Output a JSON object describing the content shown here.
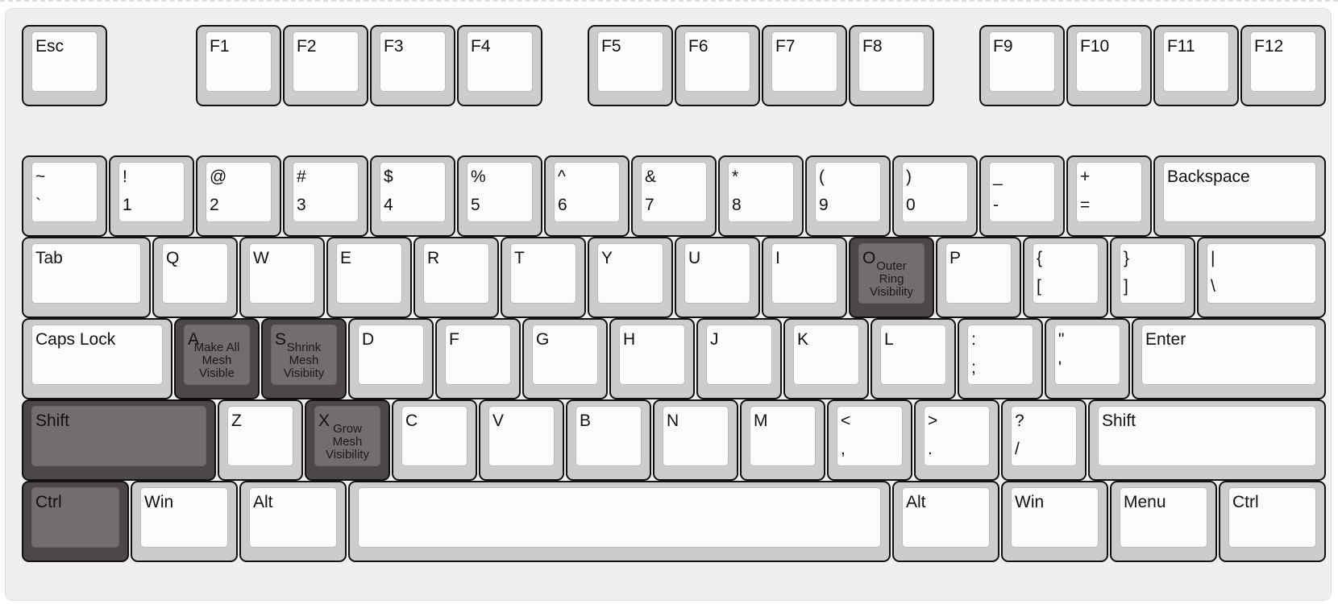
{
  "colors": {
    "key_base": "#cccccc",
    "key_face": "#fcfcfc",
    "highlight_base": "#4d4747",
    "highlight_face": "#736d6d"
  },
  "rows": [
    [
      {
        "top": "Esc"
      },
      {
        "top": "F1"
      },
      {
        "top": "F2"
      },
      {
        "top": "F3"
      },
      {
        "top": "F4"
      },
      {
        "top": "F5"
      },
      {
        "top": "F6"
      },
      {
        "top": "F7"
      },
      {
        "top": "F8"
      },
      {
        "top": "F9"
      },
      {
        "top": "F10"
      },
      {
        "top": "F11"
      },
      {
        "top": "F12"
      }
    ],
    [
      {
        "top": "~",
        "bottom": "`"
      },
      {
        "top": "!",
        "bottom": "1"
      },
      {
        "top": "@",
        "bottom": "2"
      },
      {
        "top": "#",
        "bottom": "3"
      },
      {
        "top": "$",
        "bottom": "4"
      },
      {
        "top": "%",
        "bottom": "5"
      },
      {
        "top": "^",
        "bottom": "6"
      },
      {
        "top": "&",
        "bottom": "7"
      },
      {
        "top": "*",
        "bottom": "8"
      },
      {
        "top": "(",
        "bottom": "9"
      },
      {
        "top": ")",
        "bottom": "0"
      },
      {
        "top": "_",
        "bottom": "-"
      },
      {
        "top": "+",
        "bottom": "="
      },
      {
        "top": "Backspace"
      }
    ],
    [
      {
        "top": "Tab"
      },
      {
        "top": "Q"
      },
      {
        "top": "W"
      },
      {
        "top": "E"
      },
      {
        "top": "R"
      },
      {
        "top": "T"
      },
      {
        "top": "Y"
      },
      {
        "top": "U"
      },
      {
        "top": "I"
      },
      {
        "top": "O",
        "action": "Outer Ring Visibility",
        "highlighted": true
      },
      {
        "top": "P"
      },
      {
        "top": "{",
        "bottom": "["
      },
      {
        "top": "}",
        "bottom": "]"
      },
      {
        "top": "|",
        "bottom": "\\"
      }
    ],
    [
      {
        "top": "Caps Lock"
      },
      {
        "top": "A",
        "action": "Make All Mesh Visible",
        "highlighted": true
      },
      {
        "top": "S",
        "action": "Shrink Mesh Visibiity",
        "highlighted": true
      },
      {
        "top": "D"
      },
      {
        "top": "F"
      },
      {
        "top": "G"
      },
      {
        "top": "H"
      },
      {
        "top": "J"
      },
      {
        "top": "K"
      },
      {
        "top": "L"
      },
      {
        "top": ":",
        "bottom": ";"
      },
      {
        "top": "\"",
        "bottom": "'"
      },
      {
        "top": "Enter"
      }
    ],
    [
      {
        "top": "Shift",
        "highlighted": true
      },
      {
        "top": "Z"
      },
      {
        "top": "X",
        "action": "Grow Mesh Visibility",
        "highlighted": true
      },
      {
        "top": "C"
      },
      {
        "top": "V"
      },
      {
        "top": "B"
      },
      {
        "top": "N"
      },
      {
        "top": "M"
      },
      {
        "top": "<",
        "bottom": ","
      },
      {
        "top": ">",
        "bottom": "."
      },
      {
        "top": "?",
        "bottom": "/"
      },
      {
        "top": "Shift"
      }
    ],
    [
      {
        "top": "Ctrl",
        "highlighted": true
      },
      {
        "top": "Win"
      },
      {
        "top": "Alt"
      },
      {
        "top": ""
      },
      {
        "top": "Alt"
      },
      {
        "top": "Win"
      },
      {
        "top": "Menu"
      },
      {
        "top": "Ctrl"
      }
    ]
  ]
}
